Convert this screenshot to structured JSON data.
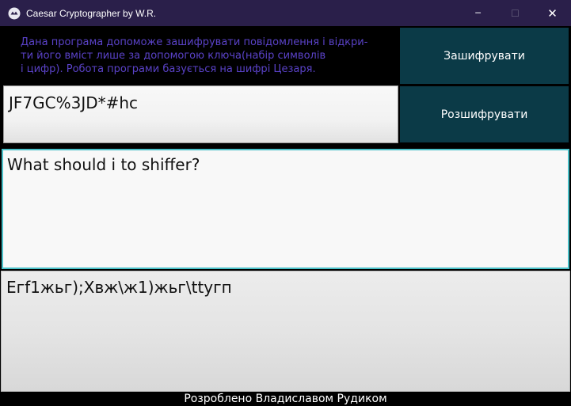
{
  "window": {
    "title": "Caesar Cryptographer by W.R.",
    "minimize_glyph": "─",
    "maximize_glyph": "☐",
    "close_glyph": "✕"
  },
  "info_text": "Дана програма допоможе зашифрувати повідомлення і відкри-\nти його вміст лише за допомогою ключа(набір символів\nі цифр). Робота програми базується на шифрі Цезаря.",
  "key_field": {
    "value": "JF7GC%3JD*#hc"
  },
  "buttons": {
    "encrypt_label": "Зашифрувати",
    "decrypt_label": "Розшифрувати"
  },
  "input_area": {
    "value": "What should i to shiffer?"
  },
  "output_area": {
    "value": "Eгf1жьг);Хвж\\ж1)жьг\\ttyгп"
  },
  "footer": "Розроблено Владиславом Рудиком",
  "colors": {
    "titlebar_bg": "#2a1f4a",
    "info_text": "#5a42c8",
    "button_bg": "#0b3a47",
    "input_focus_border": "#49c0c8"
  },
  "icons": {
    "app_icon": "kivy-logo-icon"
  }
}
